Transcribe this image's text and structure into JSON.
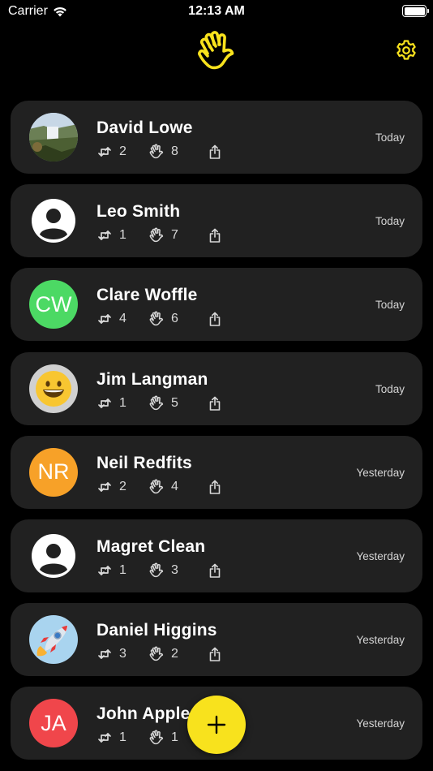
{
  "status_bar": {
    "carrier": "Carrier",
    "time": "12:13 AM"
  },
  "header": {
    "logo_icon": "waving-hand-icon",
    "settings_icon": "gear-icon",
    "accent_color": "#F8E21D"
  },
  "contacts": [
    {
      "name": "David Lowe",
      "reposts": "2",
      "waves": "8",
      "date": "Today",
      "avatar_type": "photo-waterfall"
    },
    {
      "name": "Leo Smith",
      "reposts": "1",
      "waves": "7",
      "date": "Today",
      "avatar_type": "placeholder"
    },
    {
      "name": "Clare Woffle",
      "reposts": "4",
      "waves": "6",
      "date": "Today",
      "avatar_type": "initials",
      "initials": "CW",
      "avatar_color": "#4CD964"
    },
    {
      "name": "Jim Langman",
      "reposts": "1",
      "waves": "5",
      "date": "Today",
      "avatar_type": "emoji-grin"
    },
    {
      "name": "Neil Redfits",
      "reposts": "2",
      "waves": "4",
      "date": "Yesterday",
      "avatar_type": "initials",
      "initials": "NR",
      "avatar_color": "#F7A128"
    },
    {
      "name": "Magret Clean",
      "reposts": "1",
      "waves": "3",
      "date": "Yesterday",
      "avatar_type": "placeholder"
    },
    {
      "name": "Daniel Higgins",
      "reposts": "3",
      "waves": "2",
      "date": "Yesterday",
      "avatar_type": "emoji-rocket"
    },
    {
      "name": "John Apple",
      "reposts": "1",
      "waves": "1",
      "date": "Yesterday",
      "avatar_type": "initials",
      "initials": "JA",
      "avatar_color": "#F0464B"
    }
  ],
  "fab": {
    "icon": "plus-icon"
  }
}
